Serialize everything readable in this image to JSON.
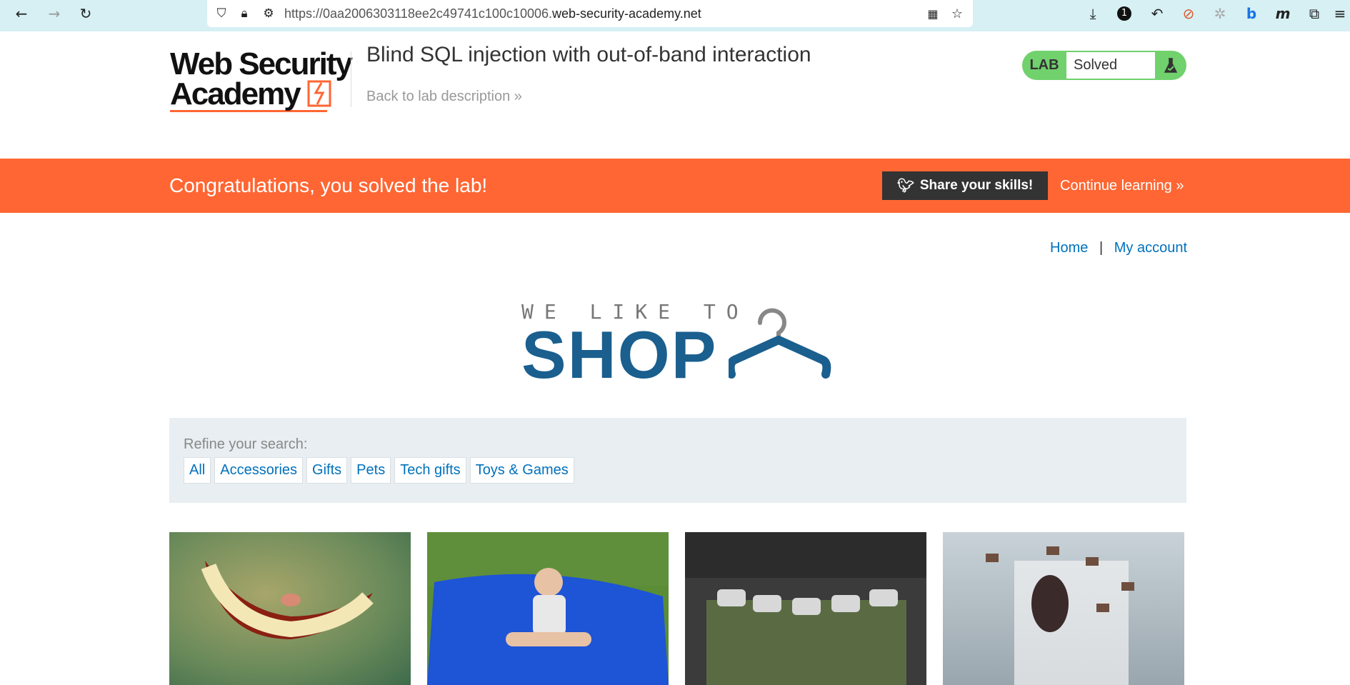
{
  "browser": {
    "url_prefix": "https://0aa2006303118ee2c49741c100c10006.",
    "url_domain": "web-security-academy.net",
    "notif_count": "1"
  },
  "academy": {
    "logo_line1": "Web Security",
    "logo_line2": "Academy",
    "lab_title": "Blind SQL injection with out-of-band interaction",
    "back_link": "Back to lab description",
    "lab_label": "LAB",
    "lab_status": "Solved",
    "badge_color": "#70d16d"
  },
  "banner": {
    "message": "Congratulations, you solved the lab!",
    "share_label": "Share your skills!",
    "continue_label": "Continue learning",
    "color": "#ff6633"
  },
  "nav": {
    "home": "Home",
    "separator": "|",
    "account": "My account"
  },
  "shop_logo": {
    "line1": "WE LIKE TO",
    "line2": "SHOP"
  },
  "filter": {
    "label": "Refine your search:",
    "categories": [
      "All",
      "Accessories",
      "Gifts",
      "Pets",
      "Tech gifts",
      "Toys & Games"
    ]
  },
  "products": [
    {
      "icon": "smile-teeth-image"
    },
    {
      "icon": "beanbag-child-image"
    },
    {
      "icon": "can-belt-image"
    },
    {
      "icon": "flying-books-image"
    }
  ]
}
